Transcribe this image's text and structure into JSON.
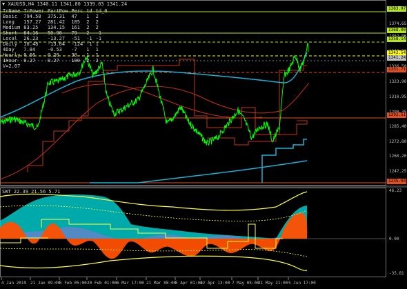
{
  "window": {
    "title": "XAUUSD,H4  1340.11 1341.80 1339.03 1341.24",
    "symbol": "XAUUSD",
    "timeframe": "H4",
    "ohlc": [
      "1340.11",
      "1341.80",
      "1339.03",
      "1341.24"
    ]
  },
  "stats_table": {
    "headers": [
      "TrName",
      "TrPower",
      "PartPow",
      "Perc",
      "td",
      "td_0"
    ],
    "rows": [
      [
        "Basic",
        "794.58",
        "375.31",
        "47",
        "1",
        "2"
      ],
      [
        "Long",
        "157.27",
        "281.42",
        "185",
        "2",
        "2"
      ],
      [
        "Medium",
        "83.25",
        "134.15",
        "161",
        "2",
        "2"
      ],
      [
        "Short",
        "64.16",
        "50.90",
        "79",
        "2",
        "-1"
      ],
      [
        "Local",
        "26.23",
        "-13.27",
        "-51",
        "-1",
        "-1"
      ],
      [
        "Daily",
        "10.48",
        "-13.04",
        "-124",
        "-1",
        "1"
      ],
      [
        "4Day",
        "7.84",
        "-0.53",
        "-7",
        "1",
        "1"
      ],
      [
        "Hourly",
        "0.66",
        "0.20",
        "30",
        "1",
        "1"
      ],
      [
        "1Hour",
        "0.27",
        "0.27",
        "100",
        "2",
        "2"
      ]
    ],
    "footer": "V=2.07"
  },
  "price_axis": {
    "ticks": [
      "1387.10",
      "1374.65",
      "1362.06",
      "1349.50",
      "1336.50",
      "1323.90",
      "1310.95",
      "1298.35",
      "1285.40",
      "1272.80",
      "1260.20",
      "1247.25"
    ],
    "labels": [
      {
        "text": "1383.97",
        "color": "#b5e61d"
      },
      {
        "text": "1368.00",
        "color": "#b5e61d"
      },
      {
        "text": "1358.14",
        "color": "#b5e61d"
      },
      {
        "text": "1342.54",
        "color": "#ffff00"
      },
      {
        "text": "1341.24",
        "color": "#c0c0c0"
      },
      {
        "text": "1331.71",
        "color": "#e05020"
      },
      {
        "text": "1292.51",
        "color": "#e05020"
      },
      {
        "text": "1235.03",
        "color": "#e05020"
      }
    ]
  },
  "oscillator": {
    "title": "SWT 22.39 21.56 5.71",
    "ticks": [
      "46.23",
      "0.00",
      "-35.81"
    ]
  },
  "time_axis": {
    "ticks": [
      "4 Jan 2019",
      "21 Jan 09:00",
      "5 Feb 05:00",
      "20 Feb 01:00",
      "6 Mar 17:00",
      "21 Mar 08:00",
      "5 Apr 01:00",
      "22 Apr 13:00",
      "7 May 05:00",
      "21 May 21:00",
      "5 Jun 17:00"
    ]
  },
  "colors": {
    "price_line": "#00ff00",
    "ma_blue": "#1ab2d8",
    "ma_red": "#c83214",
    "level_green": "#b5e61d",
    "level_red": "#e05020",
    "osc_cyan": "#00c8c8",
    "osc_orange": "#ff5000",
    "osc_yellow": "#ffff40",
    "osc_blue": "#5a86c8"
  }
}
